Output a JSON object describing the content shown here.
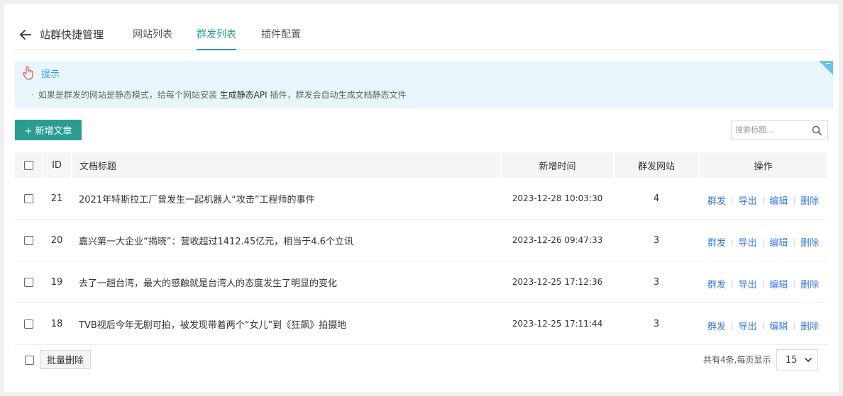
{
  "header": {
    "title": "站群快捷管理",
    "tabs": [
      {
        "label": "网站列表"
      },
      {
        "label": "群发列表"
      },
      {
        "label": "插件配置"
      }
    ]
  },
  "tip": {
    "title": "提示",
    "text_before": "如果是群发的网站是静态模式，给每个网站安装 ",
    "highlight": "生成静态API",
    "text_after": " 插件，群发会自动生成文档静态文件"
  },
  "toolbar": {
    "add_label": "+ 新增文章",
    "search_placeholder": "搜索标题..."
  },
  "table": {
    "columns": {
      "id": "ID",
      "title": "文档标题",
      "time": "新增时间",
      "sites": "群发网站",
      "ops": "操作"
    },
    "ops": {
      "publish": "群发",
      "export": "导出",
      "edit": "编辑",
      "delete": "删除"
    },
    "rows": [
      {
        "id": "21",
        "title": "2021年特斯拉工厂曾发生一起机器人“攻击”工程师的事件",
        "time": "2023-12-28 10:03:30",
        "sites": "4"
      },
      {
        "id": "20",
        "title": "嘉兴第一大企业“揭晓”：营收超过1412.45亿元，相当于4.6个立讯",
        "time": "2023-12-26 09:47:33",
        "sites": "3"
      },
      {
        "id": "19",
        "title": "去了一趟台湾，最大的感触就是台湾人的态度发生了明显的变化",
        "time": "2023-12-25 17:12:36",
        "sites": "3"
      },
      {
        "id": "18",
        "title": "TVB视后今年无剧可拍，被发现带着两个“女儿”到《狂飙》拍摄地",
        "time": "2023-12-25 17:11:44",
        "sites": "3"
      }
    ]
  },
  "footer": {
    "batch_delete": "批量删除",
    "page_info": "共有4条,每页显示",
    "page_size": "15"
  },
  "colors": {
    "accent": "#2a9d8f",
    "link": "#3a7dd8",
    "tip_bg": "#e8f6fc"
  }
}
